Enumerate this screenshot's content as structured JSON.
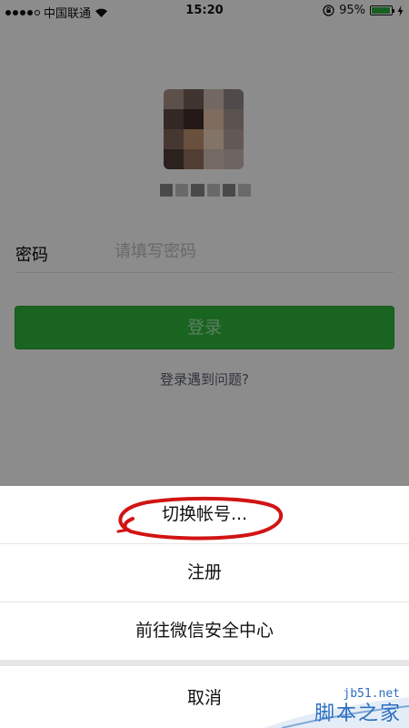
{
  "status_bar": {
    "carrier": "中国联通",
    "time": "15:20",
    "battery_percent": "95%",
    "battery_level": 0.95
  },
  "login": {
    "password_label": "密码",
    "password_placeholder": "请填写密码",
    "login_button": "登录",
    "problem_link": "登录遇到问题?"
  },
  "action_sheet": {
    "items": [
      {
        "label": "切换帐号..."
      },
      {
        "label": "注册"
      },
      {
        "label": "前往微信安全中心"
      }
    ],
    "cancel_label": "取消"
  },
  "watermark": {
    "site": "jb51.net",
    "name": "脚本之家"
  },
  "colors": {
    "wechat_green": "#2bad3a",
    "annotation_red": "#d11414",
    "watermark_blue": "#2b6fc0"
  }
}
